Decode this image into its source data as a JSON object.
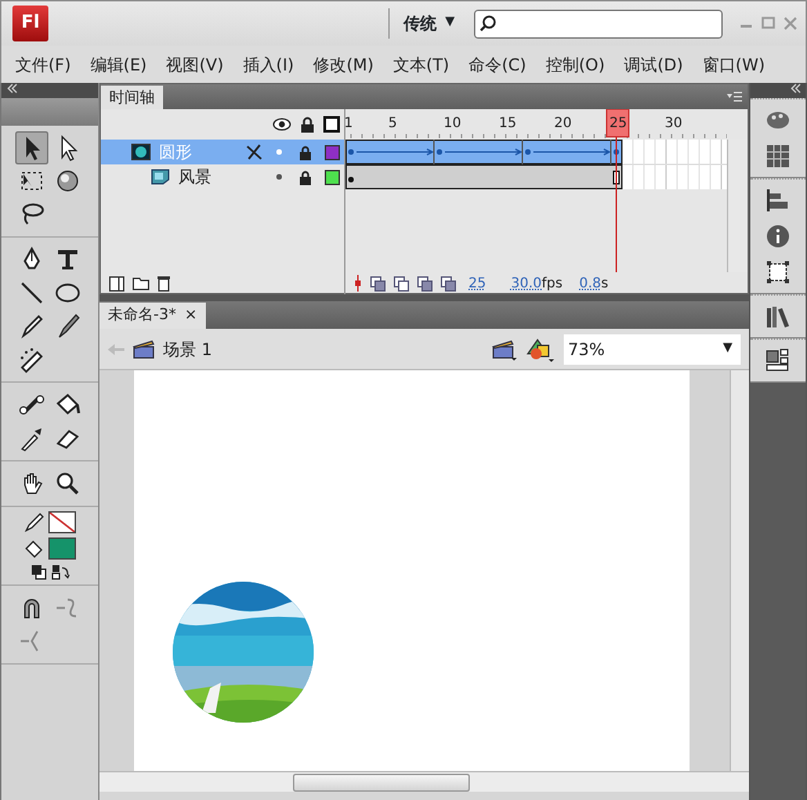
{
  "titlebar": {
    "logo": "Fl",
    "workspace": "传统",
    "workspace_caret": "▼"
  },
  "menu": [
    "文件(F)",
    "编辑(E)",
    "视图(V)",
    "插入(I)",
    "修改(M)",
    "文本(T)",
    "命令(C)",
    "控制(O)",
    "调试(D)",
    "窗口(W)"
  ],
  "tools": [
    {
      "selected": true
    },
    {
      "selected": false
    },
    {
      "selected": false
    },
    {
      "selected": false
    },
    {
      "selected": false
    },
    {
      "selected": false
    },
    {
      "selected": false
    },
    {
      "selected": false
    },
    {
      "selected": false
    },
    {
      "selected": false
    },
    {
      "selected": false
    },
    {
      "selected": false
    },
    {
      "selected": false
    },
    {
      "selected": false
    },
    {
      "selected": false
    },
    {
      "selected": false
    },
    {
      "selected": false
    },
    {
      "selected": false
    },
    {
      "selected": false
    },
    {
      "selected": false
    },
    {
      "selected": false
    }
  ],
  "colors": {
    "stroke_none": true,
    "fill": {
      "color": "#15936a"
    }
  },
  "timeline": {
    "tab": "时间轴",
    "frame_numbers": [
      "1",
      "5",
      "10",
      "15",
      "20",
      "25",
      "30"
    ],
    "layers": [
      {
        "name": "圆形",
        "selected": true,
        "kind": "motion-tween",
        "editable": false,
        "locked": true,
        "color": "#8e2fc4"
      },
      {
        "name": "风景",
        "selected": false,
        "kind": "static",
        "editable": true,
        "locked": true,
        "color": "#4ee04e"
      }
    ],
    "current_frame": "25",
    "fps": "30.0",
    "fps_unit": "fps",
    "time": "0.8",
    "time_unit": "s"
  },
  "document": {
    "tab": "未命名-3*",
    "close": "×",
    "scene": "场景 1",
    "zoom": "73%",
    "zoom_caret": "▼"
  }
}
